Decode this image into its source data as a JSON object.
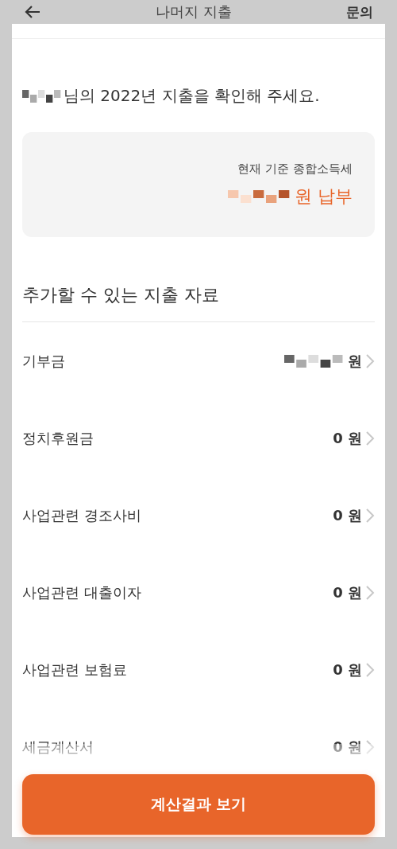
{
  "header": {
    "title": "나머지 지출",
    "action": "문의"
  },
  "greeting": {
    "text": "님의 2022년 지출을 확인해 주세요.",
    "name_masked": true
  },
  "summary": {
    "label": "현재 기준 종합소득세",
    "amount_masked": true,
    "value": "원 납부"
  },
  "section_title": "추가할 수 있는 지출 자료",
  "items": [
    {
      "label": "기부금",
      "amount": "원",
      "masked": true
    },
    {
      "label": "정치후원금",
      "amount": "0 원",
      "masked": false
    },
    {
      "label": "사업관련 경조사비",
      "amount": "0 원",
      "masked": false
    },
    {
      "label": "사업관련 대출이자",
      "amount": "0 원",
      "masked": false
    },
    {
      "label": "사업관련 보험료",
      "amount": "0 원",
      "masked": false
    },
    {
      "label": "세금계산서",
      "amount": "0 원",
      "masked": false
    }
  ],
  "button": "계산결과 보기"
}
